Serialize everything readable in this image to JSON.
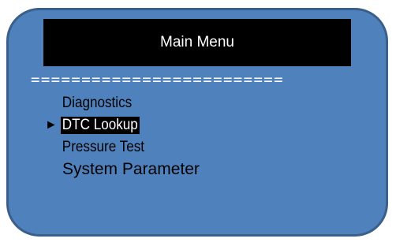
{
  "header": {
    "title": "Main Menu"
  },
  "divider": "=========================",
  "menu": {
    "cursor_glyph": "►",
    "selected_index": 1,
    "items": [
      {
        "label": "Diagnostics"
      },
      {
        "label": "DTC Lookup"
      },
      {
        "label": "Pressure Test"
      },
      {
        "label": "System Parameter"
      }
    ]
  },
  "colors": {
    "screen_background": "#4f81bd",
    "title_background": "#000000",
    "selection_background": "#000000"
  }
}
